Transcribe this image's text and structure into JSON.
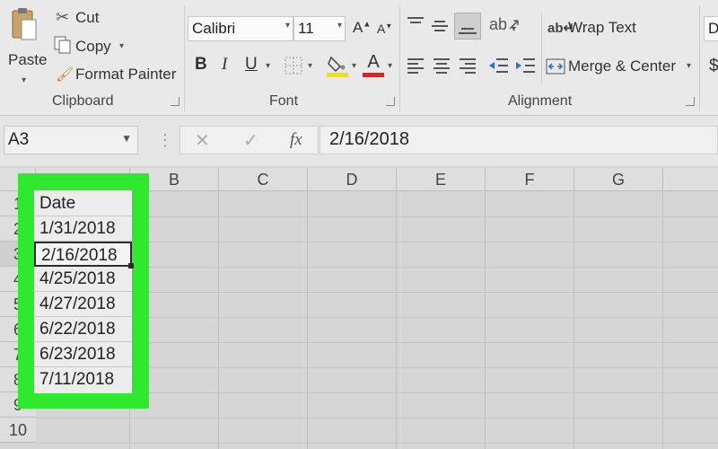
{
  "ribbon": {
    "clipboard": {
      "paste_label": "Paste",
      "cut_label": "Cut",
      "copy_label": "Copy",
      "format_painter_label": "Format Painter",
      "group_label": "Clipboard"
    },
    "font": {
      "font_name": "Calibri",
      "font_size": "11",
      "bold": "B",
      "italic": "I",
      "underline": "U",
      "grow": "A",
      "shrink": "A",
      "color_letter": "A",
      "group_label": "Font"
    },
    "alignment": {
      "wrap_text_label": "Wrap Text",
      "merge_center_label": "Merge & Center",
      "group_label": "Alignment"
    },
    "number": {
      "format_partial": "D",
      "currency_symbol": "$"
    }
  },
  "formula_bar": {
    "name_box": "A3",
    "fx": "fx",
    "formula_value": "2/16/2018"
  },
  "columns": [
    "B",
    "C",
    "D",
    "E",
    "F",
    "G"
  ],
  "rows": [
    "1",
    "2",
    "3",
    "4",
    "5",
    "6",
    "7",
    "8",
    "9",
    "10"
  ],
  "column_a": [
    "Date",
    "1/31/2018",
    "2/16/2018",
    "4/25/2018",
    "4/27/2018",
    "6/22/2018",
    "6/23/2018",
    "7/11/2018"
  ],
  "colors": {
    "highlight": "#2fe92f",
    "font_color_bar": "#e02020",
    "fill_color_bar": "#f5e000"
  }
}
